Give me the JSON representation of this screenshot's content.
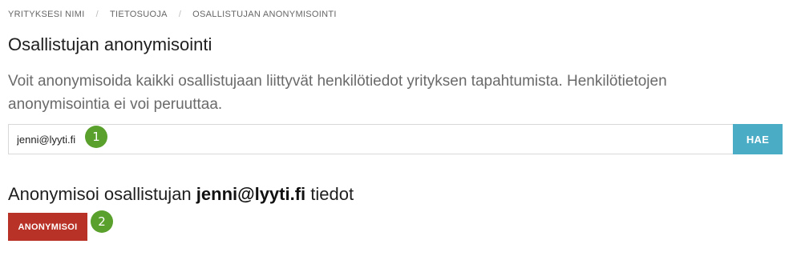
{
  "breadcrumb": {
    "items": [
      "YRITYKSESI NIMI",
      "TIETOSUOJA",
      "OSALLISTUJAN ANONYMISOINTI"
    ],
    "separator": "/"
  },
  "page": {
    "title": "Osallistujan anonymisointi",
    "description": "Voit anonymisoida kaikki osallistujaan liittyvät henkilötiedot yrityksen tapahtumista. Henkilötietojen anonymisointia ei voi peruuttaa."
  },
  "search": {
    "value": "jenni@lyyti.fi",
    "button_label": "HAE"
  },
  "result": {
    "heading_prefix": "Anonymisoi osallistujan",
    "email": "jenni@lyyti.fi",
    "heading_suffix": "tiedot",
    "button_label": "ANONYMISOI"
  },
  "annotations": {
    "step1": "1",
    "step2": "2"
  },
  "colors": {
    "search_button": "#4bacc6",
    "anonymize_button": "#b83227",
    "step_badge": "#5aa02c"
  }
}
